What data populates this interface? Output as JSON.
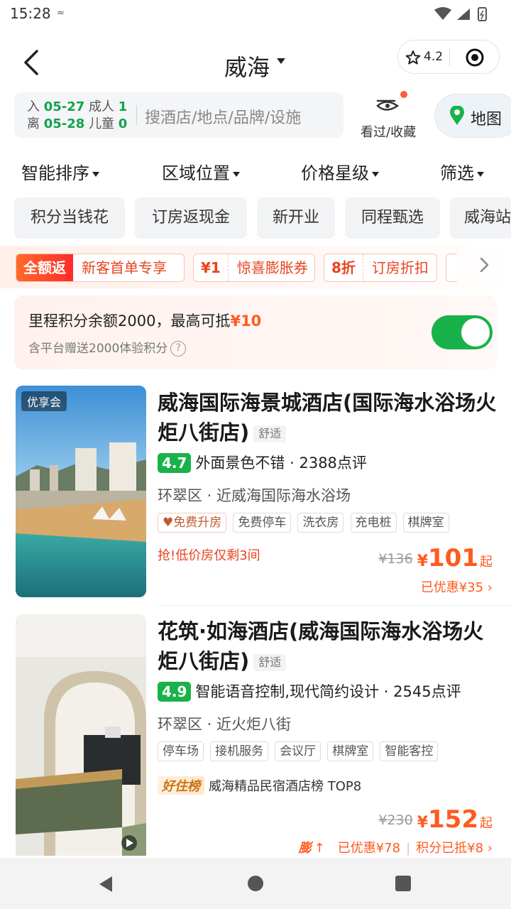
{
  "status_bar": {
    "time": "15:28",
    "indicator": "≈"
  },
  "header": {
    "city": "威海",
    "rating": "4.2"
  },
  "search": {
    "checkin_label": "入",
    "checkin_date": "05-27",
    "checkout_label": "离",
    "checkout_date": "05-28",
    "adults_label": "成人",
    "adults": "1",
    "children_label": "儿童",
    "children": "0",
    "placeholder": "搜酒店/地点/品牌/设施",
    "seen_label": "看过/收藏",
    "map_label": "地图"
  },
  "filters": [
    "智能排序",
    "区域位置",
    "价格星级",
    "筛选"
  ],
  "chips": [
    "积分当钱花",
    "订房返现金",
    "新开业",
    "同程甄选",
    "威海站"
  ],
  "promos": [
    {
      "tag": "全额返",
      "text": "新客首单专享"
    },
    {
      "tag": "¥1",
      "text": "惊喜膨胀券"
    },
    {
      "tag": "8折",
      "text": "订房折扣"
    }
  ],
  "mileage": {
    "line1": "里程积分余额2000，最高可抵",
    "amount": "¥10",
    "line2": "含平台赠送2000体验积分",
    "enabled": true
  },
  "hotels": [
    {
      "vip_badge": "优享会",
      "name": "威海国际海景城酒店(国际海水浴场火炬八街店)",
      "level": "舒适",
      "score": "4.7",
      "highlight": "外面景色不错",
      "reviews": "2388点评",
      "location": "环翠区 · 近威海国际海水浴场",
      "tags": [
        "免费升房",
        "免费停车",
        "洗衣房",
        "充电桩",
        "棋牌室"
      ],
      "urgent": "抢!低价房仅剩3间",
      "original_price": "¥136",
      "currency": "¥",
      "price": "101",
      "price_suffix": "起",
      "saving": "已优惠¥35 ›"
    },
    {
      "name": "花筑·如海酒店(威海国际海水浴场火炬八街店)",
      "level": "舒适",
      "score": "4.9",
      "highlight": "智能语音控制,现代简约设计",
      "reviews": "2545点评",
      "location": "环翠区 · 近火炬八街",
      "tags": [
        "停车场",
        "接机服务",
        "会议厅",
        "棋牌室",
        "智能客控"
      ],
      "rank_label": "好住榜",
      "rank_text": "威海精品民宿酒店榜 TOP8",
      "original_price": "¥230",
      "currency": "¥",
      "price": "152",
      "price_suffix": "起",
      "boost_label": "膨",
      "saving": "已优惠¥78",
      "points_used": "积分已抵¥8 ›"
    }
  ]
}
